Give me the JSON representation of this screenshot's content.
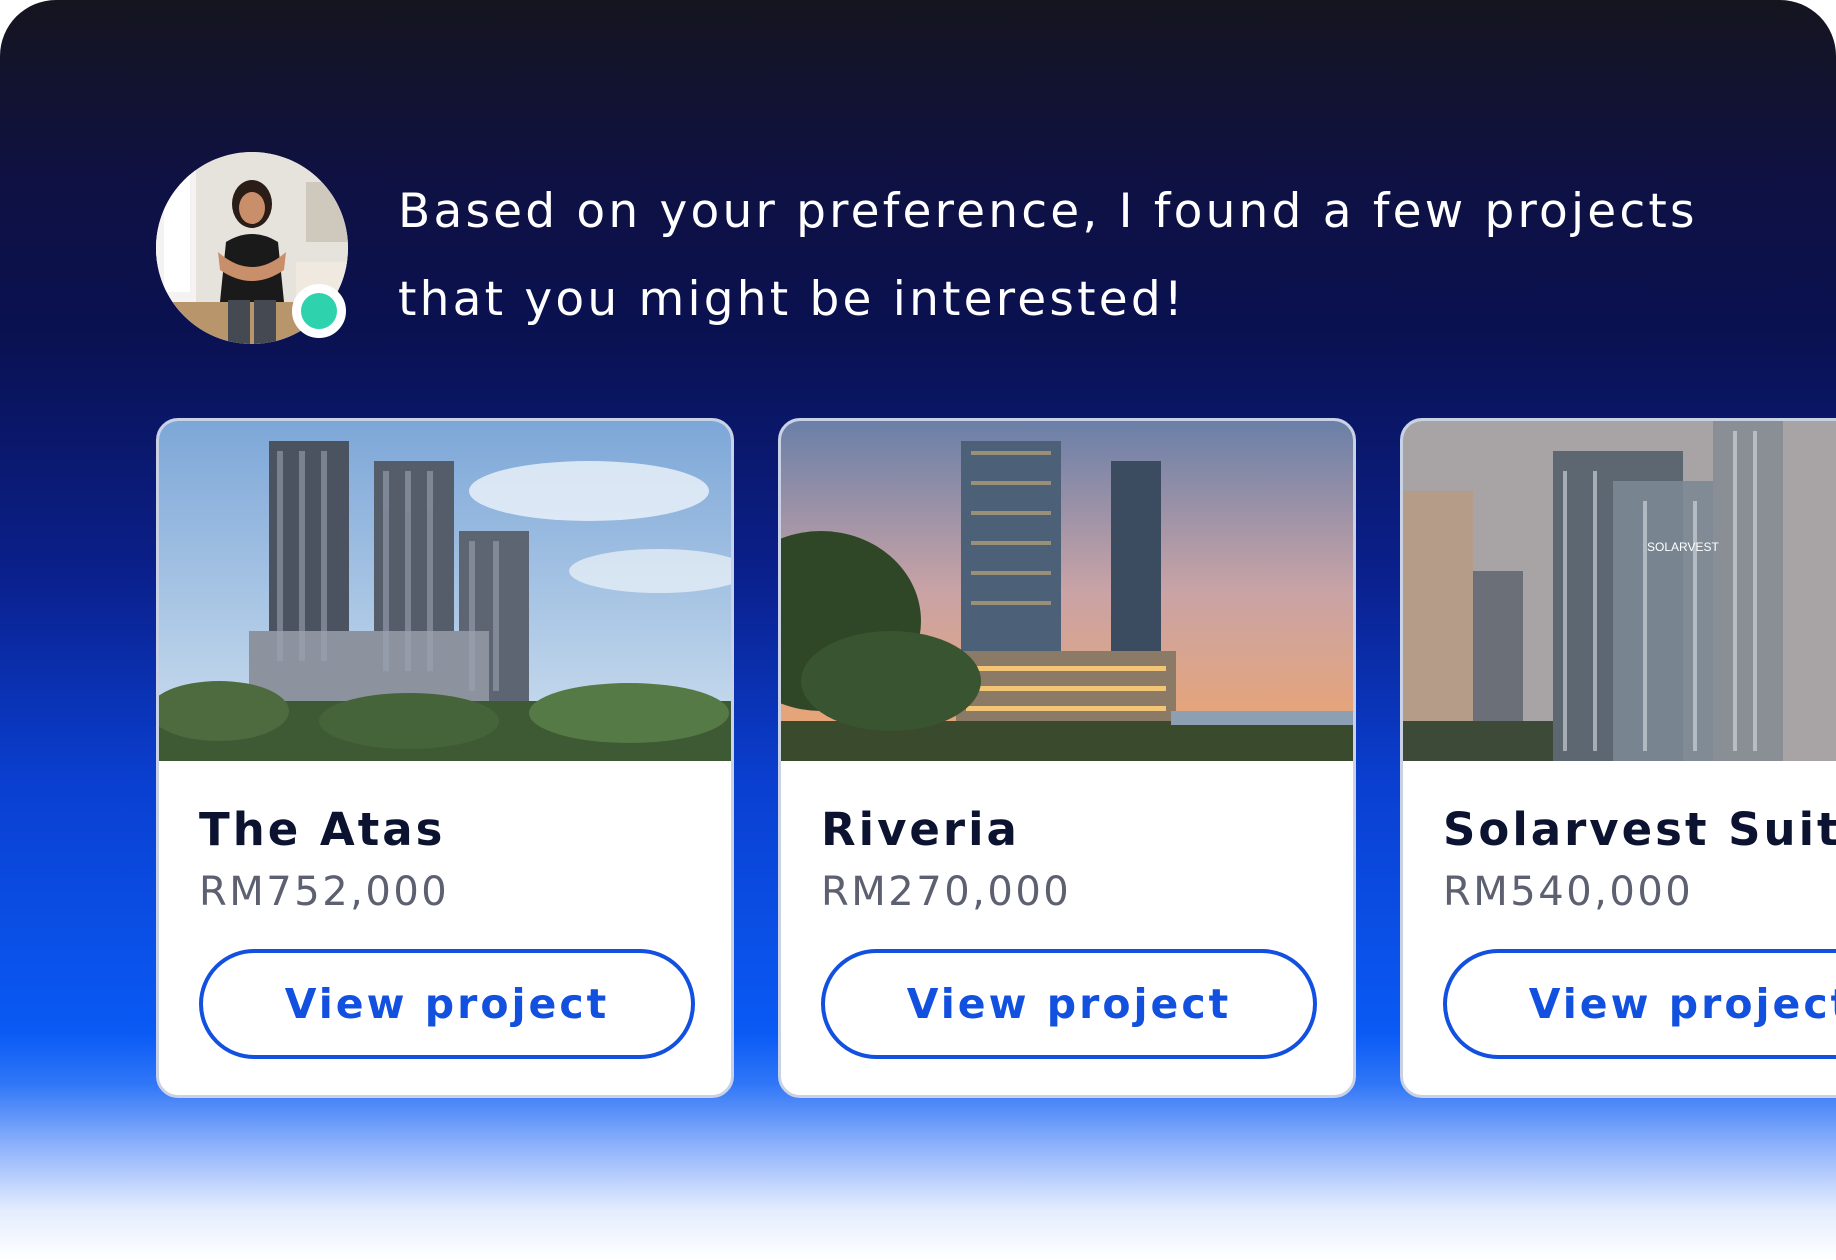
{
  "chat": {
    "agent_avatar": "agent-avatar-photo",
    "status_color": "#2ed3ad",
    "message_line1": "Based on your preference, I found a few projects",
    "message_line2": "that you might be interested!"
  },
  "projects": [
    {
      "name": "The Atas",
      "price": "RM752,000",
      "button_label": "View project"
    },
    {
      "name": "Riveria",
      "price": "RM270,000",
      "button_label": "View project"
    },
    {
      "name": "Solarvest Suites",
      "price": "RM540,000",
      "button_label": "View project",
      "image_sign": "SOLARVEST"
    }
  ],
  "colors": {
    "accent": "#1250e0",
    "title": "#0c1330",
    "price": "#5c6070",
    "status_online": "#2ed3ad"
  }
}
